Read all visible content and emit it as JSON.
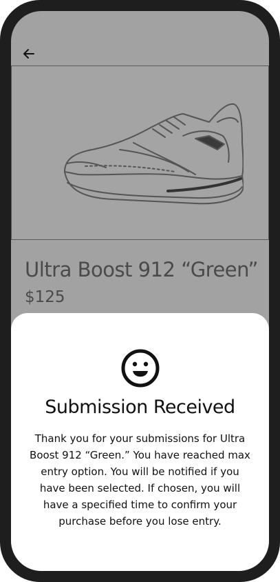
{
  "header": {
    "back_icon": "arrow-left-icon"
  },
  "product": {
    "image_icon": "sneaker-image",
    "name": "Ultra Boost 912 “Green”",
    "price": "$125"
  },
  "modal": {
    "icon": "smiley-icon",
    "title": "Submission Received",
    "message": "Thank you for your submissions for Ultra Boost 912 “Green.” You have reached max entry option. You will be notified if you have been selected. If chosen, you will have a specified time to confirm your purchase before you lose entry."
  },
  "colors": {
    "overlay": "#a2a2a2",
    "frame": "#1e1e1e",
    "sheet": "#ffffff",
    "text": "#111111"
  }
}
